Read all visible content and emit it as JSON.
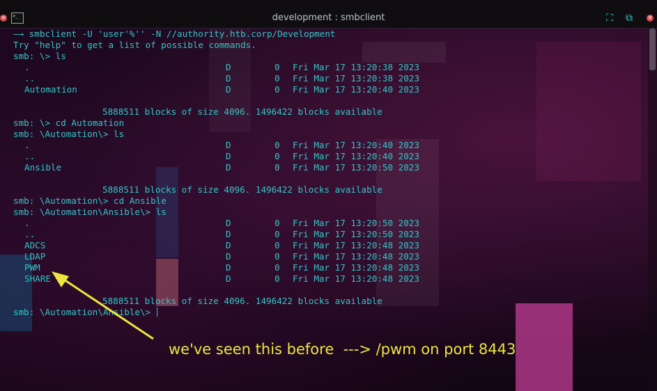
{
  "window": {
    "title": "development : smbclient",
    "close_label": "×"
  },
  "terminal": {
    "lines": [
      "—→ smbclient -U 'user'%'' -N //authority.htb.corp/Development",
      "Try \"help\" to get a list of possible commands.",
      "smb: \\> ls"
    ],
    "listing1": [
      {
        "name": ".",
        "type": "D",
        "size": "0",
        "date": "Fri Mar 17 13:20:38 2023"
      },
      {
        "name": "..",
        "type": "D",
        "size": "0",
        "date": "Fri Mar 17 13:20:38 2023"
      },
      {
        "name": "Automation",
        "type": "D",
        "size": "0",
        "date": "Fri Mar 17 13:20:40 2023"
      }
    ],
    "blocks1": "5888511 blocks of size 4096. 1496422 blocks available",
    "cmd2": "smb: \\> cd Automation",
    "cmd3": "smb: \\Automation\\> ls",
    "listing2": [
      {
        "name": ".",
        "type": "D",
        "size": "0",
        "date": "Fri Mar 17 13:20:40 2023"
      },
      {
        "name": "..",
        "type": "D",
        "size": "0",
        "date": "Fri Mar 17 13:20:40 2023"
      },
      {
        "name": "Ansible",
        "type": "D",
        "size": "0",
        "date": "Fri Mar 17 13:20:50 2023"
      }
    ],
    "blocks2": "5888511 blocks of size 4096. 1496422 blocks available",
    "cmd4": "smb: \\Automation\\> cd Ansible",
    "cmd5": "smb: \\Automation\\Ansible\\> ls",
    "listing3": [
      {
        "name": ".",
        "type": "D",
        "size": "0",
        "date": "Fri Mar 17 13:20:50 2023"
      },
      {
        "name": "..",
        "type": "D",
        "size": "0",
        "date": "Fri Mar 17 13:20:50 2023"
      },
      {
        "name": "ADCS",
        "type": "D",
        "size": "0",
        "date": "Fri Mar 17 13:20:48 2023"
      },
      {
        "name": "LDAP",
        "type": "D",
        "size": "0",
        "date": "Fri Mar 17 13:20:48 2023"
      },
      {
        "name": "PWM",
        "type": "D",
        "size": "0",
        "date": "Fri Mar 17 13:20:48 2023"
      },
      {
        "name": "SHARE",
        "type": "D",
        "size": "0",
        "date": "Fri Mar 17 13:20:48 2023"
      }
    ],
    "blocks3": "5888511 blocks of size 4096. 1496422 blocks available",
    "prompt": "smb: \\Automation\\Ansible\\> "
  },
  "annotation": {
    "text": "we've seen this before  ---> /pwm on port 8443",
    "color": "#ede640"
  },
  "colors": {
    "terminal_text": "#33c6c6",
    "close": "#e0464d",
    "titlebar_buttons": "#33d1c8"
  },
  "icons": {
    "app": "terminal-icon",
    "maximize": "maximize-icon",
    "new_tab": "new-tab-icon",
    "close": "close-icon"
  }
}
